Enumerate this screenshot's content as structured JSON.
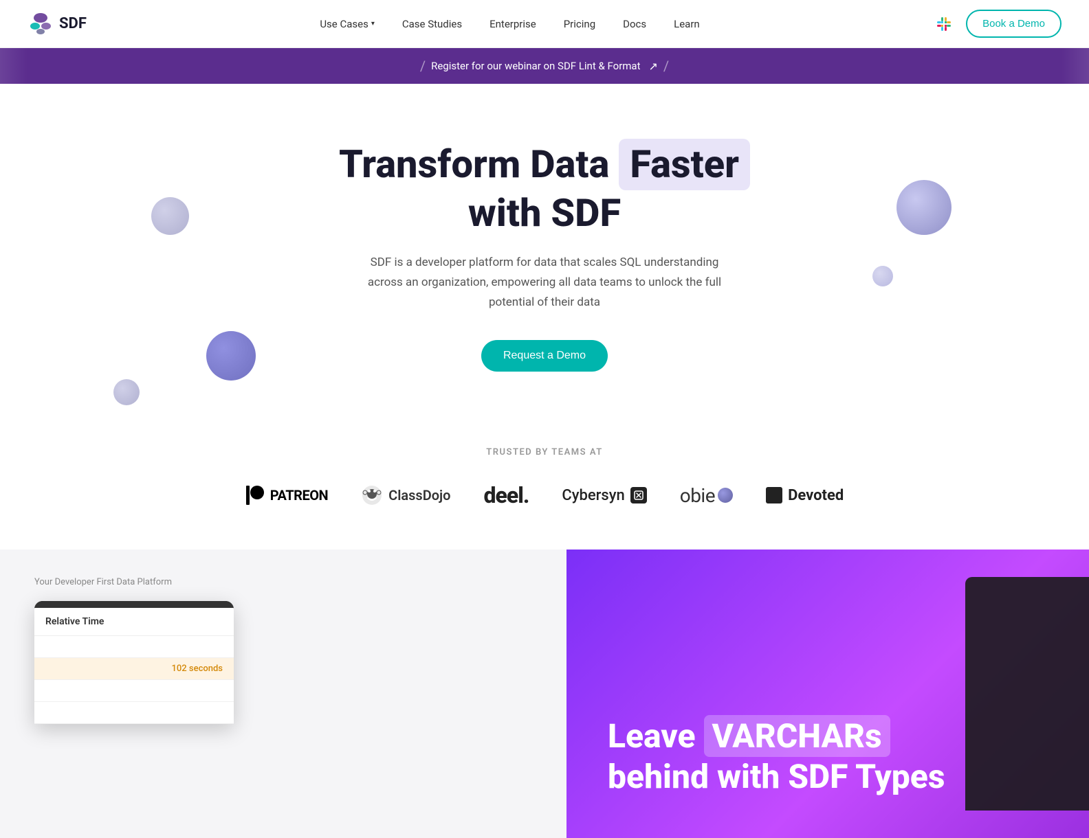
{
  "nav": {
    "logo_text": "SDF",
    "links": [
      {
        "label": "Use Cases",
        "has_dropdown": true
      },
      {
        "label": "Case Studies",
        "has_dropdown": false
      },
      {
        "label": "Enterprise",
        "has_dropdown": false
      },
      {
        "label": "Pricing",
        "has_dropdown": false
      },
      {
        "label": "Docs",
        "has_dropdown": false
      },
      {
        "label": "Learn",
        "has_dropdown": false
      }
    ],
    "book_demo": "Book a Demo"
  },
  "banner": {
    "text": "Register for our webinar on SDF Lint & Format",
    "slash1": "/",
    "slash2": "/",
    "arrow": "↗"
  },
  "hero": {
    "title_part1": "Transform Data",
    "title_highlight": "Faster",
    "title_part2": "with SDF",
    "subtitle": "SDF is a developer platform for data that scales SQL understanding across an organization, empowering all data teams to unlock the full potential of their data",
    "cta": "Request a Demo"
  },
  "trusted": {
    "label": "TRUSTED BY TEAMS AT",
    "logos": [
      {
        "name": "Patreon",
        "type": "patreon"
      },
      {
        "name": "ClassDojo",
        "type": "classdojo"
      },
      {
        "name": "deel.",
        "type": "deel"
      },
      {
        "name": "Cybersyn",
        "type": "cybersyn"
      },
      {
        "name": "obie",
        "type": "obie"
      },
      {
        "name": "Devoted",
        "type": "devoted"
      }
    ]
  },
  "bottom": {
    "left_label": "Your Developer First Data Platform",
    "card_title": "Relative Time",
    "card_value": "102 seconds",
    "right_title_part1": "Leave",
    "right_title_highlight": "VARCHARs",
    "right_title_part2": "behind with SDF Types"
  }
}
